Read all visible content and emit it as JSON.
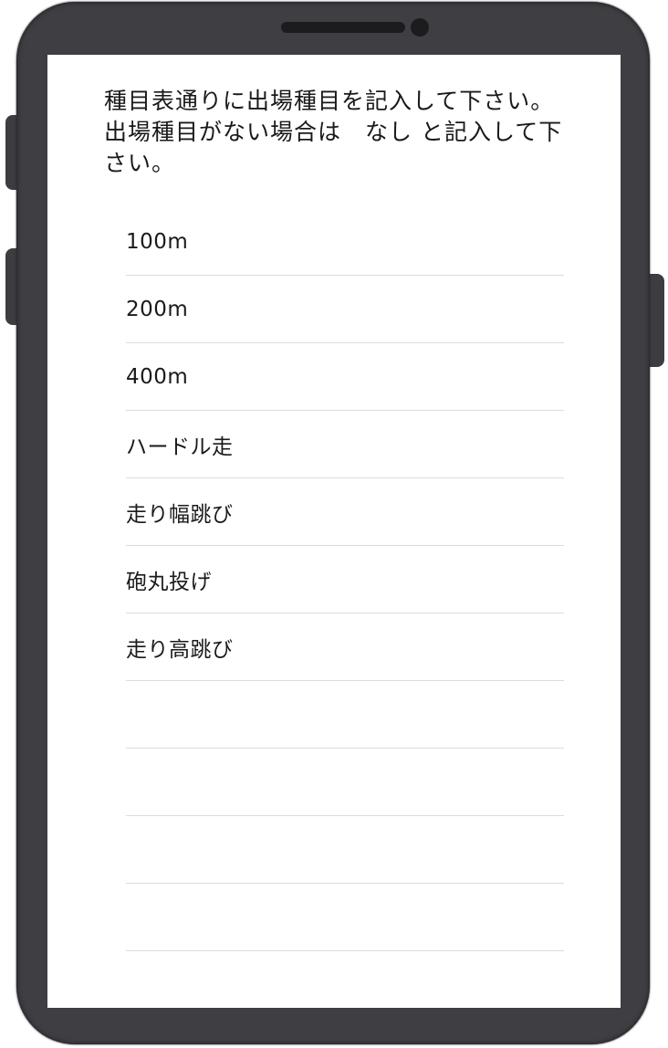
{
  "form": {
    "instruction": "種目表通りに出場種目を記入して下さい。出場種目がない場合は　なし と記入して下さい。",
    "events": [
      {
        "value": "100m"
      },
      {
        "value": "200m"
      },
      {
        "value": "400m"
      },
      {
        "value": "ハードル走"
      },
      {
        "value": "走り幅跳び"
      },
      {
        "value": "砲丸投げ"
      },
      {
        "value": "走り高跳び"
      },
      {
        "value": ""
      },
      {
        "value": ""
      },
      {
        "value": ""
      },
      {
        "value": ""
      }
    ]
  },
  "colors": {
    "phone_body": "#3f3e43",
    "screen": "#ffffff",
    "text": "#1a1a1a",
    "divider": "#dcdcdc"
  }
}
